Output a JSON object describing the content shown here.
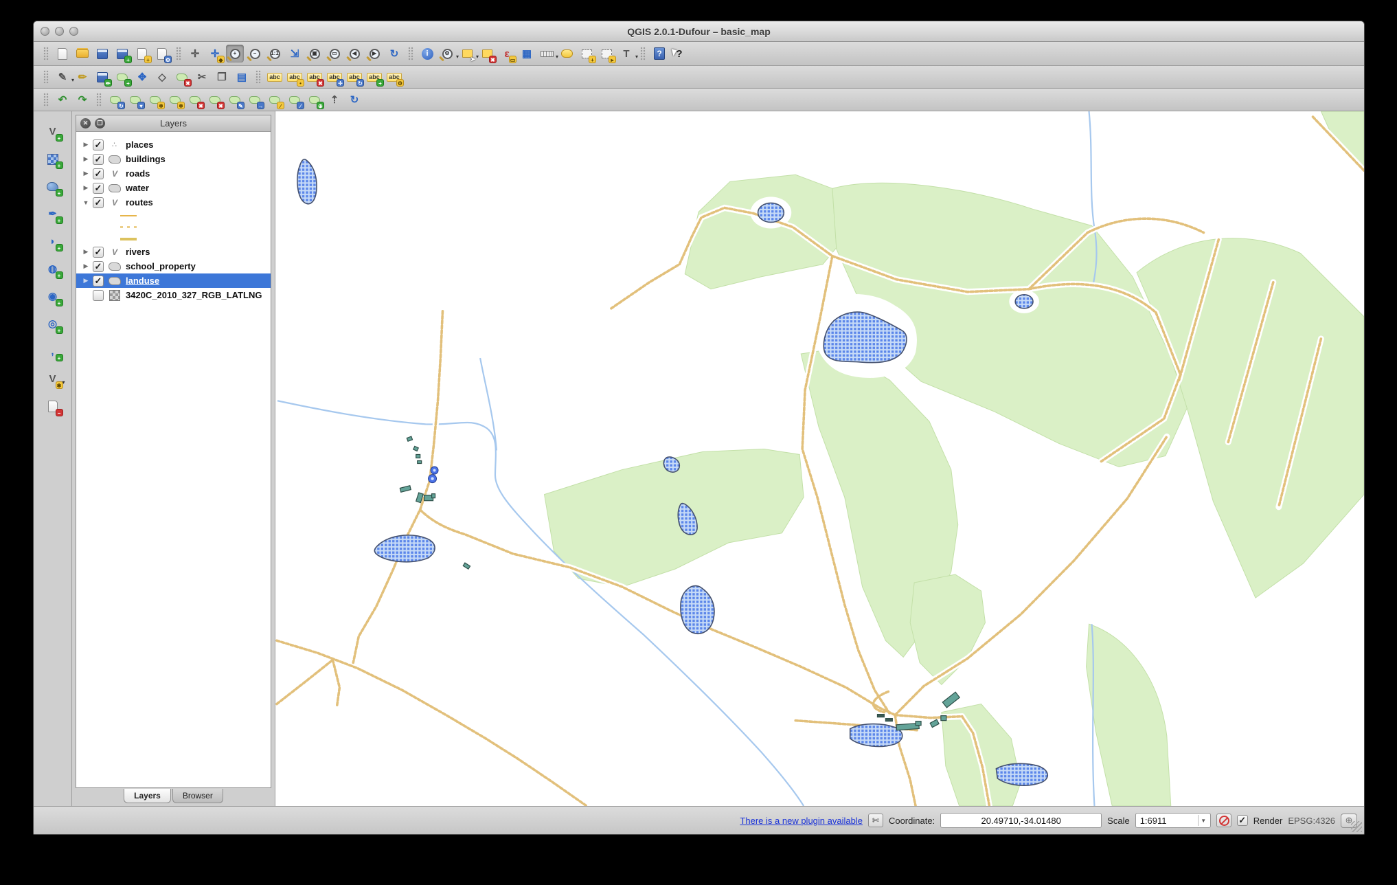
{
  "window": {
    "title": "QGIS 2.0.1-Dufour – basic_map"
  },
  "glyphs": {
    "check": "✓",
    "collapsed": "▶",
    "expanded": "▼",
    "dropdown": "▾",
    "points_icon": "∴",
    "line_icon": "V"
  },
  "toolbars": {
    "main": [
      {
        "sep": true
      },
      {
        "name": "new-project",
        "label": "New Project",
        "kind": "page"
      },
      {
        "name": "open-project",
        "label": "Open Project",
        "kind": "folder"
      },
      {
        "name": "save-project",
        "label": "Save Project",
        "kind": "save"
      },
      {
        "name": "save-project-as",
        "label": "Save Project As",
        "kind": "save",
        "badge": "+",
        "badge_tint": "green"
      },
      {
        "name": "new-print-composer",
        "label": "New Print Composer",
        "kind": "page",
        "badge": "+",
        "badge_tint": "yellow"
      },
      {
        "name": "composer-manager",
        "label": "Composer Manager",
        "kind": "page",
        "badge": "⚙",
        "badge_tint": "blue"
      },
      {
        "sep": true
      },
      {
        "name": "pan-map",
        "label": "Pan Map",
        "kind": "glyph",
        "glyph": "✛",
        "tint": "gray"
      },
      {
        "name": "pan-to-selection",
        "label": "Pan Map to Selection",
        "kind": "glyph",
        "glyph": "✛",
        "tint": "blue",
        "badge": "◆",
        "badge_tint": "yellow"
      },
      {
        "name": "zoom-in",
        "label": "Zoom In",
        "kind": "mag",
        "glyph": "+",
        "active": true
      },
      {
        "name": "zoom-out",
        "label": "Zoom Out",
        "kind": "mag",
        "glyph": "−"
      },
      {
        "name": "zoom-actual",
        "label": "Zoom to Native Resolution",
        "kind": "mag",
        "glyph": "1:1"
      },
      {
        "name": "zoom-full",
        "label": "Zoom Full",
        "kind": "glyph",
        "glyph": "⇲",
        "tint": "blue"
      },
      {
        "name": "zoom-to-selection",
        "label": "Zoom to Selection",
        "kind": "mag",
        "glyph": "▣"
      },
      {
        "name": "zoom-to-layer",
        "label": "Zoom to Layer",
        "kind": "mag",
        "glyph": "▭"
      },
      {
        "name": "zoom-last",
        "label": "Zoom Last",
        "kind": "mag",
        "glyph": "◀"
      },
      {
        "name": "zoom-next",
        "label": "Zoom Next",
        "kind": "mag",
        "glyph": "▶"
      },
      {
        "name": "refresh-map",
        "label": "Refresh",
        "kind": "glyph",
        "glyph": "↻",
        "tint": "blue"
      },
      {
        "sep": true
      },
      {
        "name": "identify-features",
        "label": "Identify Features",
        "kind": "roundblue",
        "glyph": "i"
      },
      {
        "name": "run-feature-action",
        "label": "Run Feature Action",
        "kind": "mag",
        "glyph": "⚙",
        "dropdown": true
      },
      {
        "name": "select-features",
        "label": "Select Features",
        "kind": "selrect",
        "badge": "➤",
        "badge_tint": "cursor",
        "dropdown": true
      },
      {
        "name": "deselect-features",
        "label": "Deselect Features from All Layers",
        "kind": "selrect",
        "badge": "✖",
        "badge_tint": "red"
      },
      {
        "name": "select-by-expression",
        "label": "Select by Expression",
        "kind": "glyph",
        "glyph": "ε",
        "tint": "red",
        "badge": "▭",
        "badge_tint": "yellow"
      },
      {
        "name": "open-attribute-table",
        "label": "Open Attribute Table",
        "kind": "glyph",
        "glyph": "▦",
        "tint": "blue"
      },
      {
        "name": "measure-line",
        "label": "Measure Line",
        "kind": "ruler",
        "dropdown": true
      },
      {
        "name": "map-tips",
        "label": "Map Tips",
        "kind": "bubble"
      },
      {
        "name": "new-bookmark",
        "label": "New Bookmark",
        "kind": "bookmark",
        "badge": "+",
        "badge_tint": "yellow"
      },
      {
        "name": "show-bookmarks",
        "label": "Show Bookmarks",
        "kind": "bookmark",
        "badge": "▸",
        "badge_tint": "yellow"
      },
      {
        "name": "text-annotation",
        "label": "Text Annotation",
        "kind": "glyph",
        "glyph": "T",
        "tint": "gray",
        "dropdown": true
      },
      {
        "sep": true
      },
      {
        "name": "help-contents",
        "label": "Help Contents",
        "kind": "helpbook",
        "glyph": "?"
      },
      {
        "name": "whats-this",
        "label": "What's This?",
        "kind": "cursorq",
        "glyph": "?"
      }
    ],
    "digitizing": [
      {
        "sep": true
      },
      {
        "name": "current-edits",
        "label": "Current Edits",
        "kind": "glyph",
        "glyph": "✎",
        "tint": "gray",
        "dropdown": true
      },
      {
        "name": "toggle-editing",
        "label": "Toggle Editing",
        "kind": "glyph",
        "glyph": "✏",
        "tint": "yellow"
      },
      {
        "name": "save-layer-edits",
        "label": "Save Layer Edits",
        "kind": "save",
        "badge": "✏",
        "badge_tint": "green"
      },
      {
        "name": "add-feature",
        "label": "Add Feature",
        "kind": "blob",
        "badge": "+",
        "badge_tint": "green"
      },
      {
        "name": "move-feature",
        "label": "Move Feature",
        "kind": "glyph",
        "glyph": "✥",
        "tint": "blue"
      },
      {
        "name": "node-tool",
        "label": "Node Tool",
        "kind": "glyph",
        "glyph": "◇",
        "tint": "gray"
      },
      {
        "name": "delete-selected",
        "label": "Delete Selected",
        "kind": "blob",
        "badge": "✖",
        "badge_tint": "red"
      },
      {
        "name": "cut-features",
        "label": "Cut Features",
        "kind": "glyph",
        "glyph": "✂",
        "tint": "gray"
      },
      {
        "name": "copy-features",
        "label": "Copy Features",
        "kind": "glyph",
        "glyph": "❐",
        "tint": "gray"
      },
      {
        "name": "paste-features",
        "label": "Paste Features",
        "kind": "glyph",
        "glyph": "▤",
        "tint": "blue"
      },
      {
        "sep": true
      },
      {
        "name": "labeling",
        "label": "Layer Labeling Options",
        "kind": "abc",
        "glyph": "abc"
      },
      {
        "name": "label-pin",
        "label": "Pin/Unpin Labels",
        "kind": "abc",
        "glyph": "abc",
        "badge": "•",
        "badge_tint": "yellow"
      },
      {
        "name": "label-highlight",
        "label": "Highlight Pinned Labels",
        "kind": "abc",
        "glyph": "abc",
        "badge": "✖",
        "badge_tint": "red"
      },
      {
        "name": "label-move",
        "label": "Move Label",
        "kind": "abc",
        "glyph": "abc",
        "badge": "✛",
        "badge_tint": "blue"
      },
      {
        "name": "label-rotate",
        "label": "Rotate Label",
        "kind": "abc",
        "glyph": "abc",
        "badge": "↻",
        "badge_tint": "blue"
      },
      {
        "name": "label-change",
        "label": "Change Label",
        "kind": "abc",
        "glyph": "abc",
        "badge": "+",
        "badge_tint": "green"
      },
      {
        "name": "label-properties",
        "label": "Label Properties",
        "kind": "abc",
        "glyph": "abc",
        "badge": "⚙",
        "badge_tint": "yellow"
      }
    ],
    "advanced_digitizing": [
      {
        "sep": true
      },
      {
        "name": "undo",
        "label": "Undo",
        "kind": "glyph",
        "glyph": "↶",
        "tint": "green"
      },
      {
        "name": "redo",
        "label": "Redo",
        "kind": "glyph",
        "glyph": "↷",
        "tint": "green"
      },
      {
        "sep": true
      },
      {
        "name": "rotate-feature",
        "label": "Rotate Feature",
        "kind": "blob",
        "badge": "↻",
        "badge_tint": "blue"
      },
      {
        "name": "simplify-feature",
        "label": "Simplify Feature",
        "kind": "blob",
        "badge": "▾",
        "badge_tint": "blue"
      },
      {
        "name": "add-ring",
        "label": "Add Ring",
        "kind": "blob",
        "badge": "❄",
        "badge_tint": "yellow"
      },
      {
        "name": "fill-ring",
        "label": "Fill Ring",
        "kind": "blob",
        "badge": "❄",
        "badge_tint": "yellow"
      },
      {
        "name": "delete-ring",
        "label": "Delete Ring",
        "kind": "blob",
        "badge": "✖",
        "badge_tint": "red"
      },
      {
        "name": "delete-part",
        "label": "Delete Part",
        "kind": "blob",
        "badge": "✖",
        "badge_tint": "red"
      },
      {
        "name": "reshape-features",
        "label": "Reshape Features",
        "kind": "blob",
        "badge": "✎",
        "badge_tint": "blue"
      },
      {
        "name": "offset-curve",
        "label": "Offset Curve",
        "kind": "blob",
        "badge": "→",
        "badge_tint": "blue"
      },
      {
        "name": "split-features",
        "label": "Split Features",
        "kind": "blob",
        "badge": "∕",
        "badge_tint": "yellow"
      },
      {
        "name": "split-parts",
        "label": "Split Parts",
        "kind": "blob",
        "badge": "∕",
        "badge_tint": "blue"
      },
      {
        "name": "merge-features",
        "label": "Merge Selected Features",
        "kind": "blob",
        "badge": "⊕",
        "badge_tint": "green"
      },
      {
        "name": "merge-attributes",
        "label": "Merge Attributes of Selected Features",
        "kind": "glyph",
        "glyph": "⇡",
        "tint": "gray"
      },
      {
        "name": "rotate-point-symbols",
        "label": "Rotate Point Symbols",
        "kind": "glyph",
        "glyph": "↻",
        "tint": "blue"
      }
    ],
    "manage_layers": [
      {
        "name": "add-vector-layer",
        "label": "Add Vector Layer",
        "kind": "glyph",
        "glyph": "V",
        "tint": "gray",
        "badge": "+",
        "badge_tint": "green"
      },
      {
        "name": "add-raster-layer",
        "label": "Add Raster Layer",
        "kind": "checker",
        "badge": "+",
        "badge_tint": "green"
      },
      {
        "name": "add-postgis-layer",
        "label": "Add PostGIS Layer",
        "kind": "pg",
        "badge": "+",
        "badge_tint": "green"
      },
      {
        "name": "add-spatialite-layer",
        "label": "Add SpatiaLite Layer",
        "kind": "glyph",
        "glyph": "✒",
        "tint": "blue",
        "badge": "+",
        "badge_tint": "green"
      },
      {
        "name": "add-mssql-layer",
        "label": "Add MSSQL Spatial Layer",
        "kind": "glyph",
        "glyph": "◗",
        "tint": "blue",
        "badge": "+",
        "badge_tint": "green"
      },
      {
        "name": "add-wms-layer",
        "label": "Add WMS/WMTS Layer",
        "kind": "glyph",
        "glyph": "◍",
        "tint": "blue",
        "badge": "+",
        "badge_tint": "green"
      },
      {
        "name": "add-wcs-layer",
        "label": "Add WCS Layer",
        "kind": "glyph",
        "glyph": "◉",
        "tint": "blue",
        "badge": "+",
        "badge_tint": "green"
      },
      {
        "name": "add-wfs-layer",
        "label": "Add WFS Layer",
        "kind": "glyph",
        "glyph": "◎",
        "tint": "blue",
        "badge": "+",
        "badge_tint": "green"
      },
      {
        "name": "add-delimited-text-layer",
        "label": "Add Delimited Text Layer",
        "kind": "glyph",
        "glyph": ",",
        "tint": "blue",
        "badge": "+",
        "badge_tint": "green"
      },
      {
        "name": "new-shapefile-layer",
        "label": "New Shapefile Layer",
        "kind": "glyph",
        "glyph": "V",
        "tint": "gray",
        "badge": "✱",
        "badge_tint": "yellow",
        "dropdown": true
      },
      {
        "name": "remove-layer",
        "label": "Remove Layer",
        "kind": "page",
        "badge": "−",
        "badge_tint": "red"
      }
    ]
  },
  "layers_panel": {
    "title": "Layers",
    "header_buttons": [
      {
        "name": "close-panel",
        "glyph": "✕"
      },
      {
        "name": "float-panel",
        "glyph": "❐"
      }
    ],
    "layers": [
      {
        "name": "places",
        "checked": true,
        "expand": "collapsed",
        "icon": "points"
      },
      {
        "name": "buildings",
        "checked": true,
        "expand": "collapsed",
        "icon": "polygon"
      },
      {
        "name": "roads",
        "checked": true,
        "expand": "collapsed",
        "icon": "line"
      },
      {
        "name": "water",
        "checked": true,
        "expand": "collapsed",
        "icon": "polygon"
      },
      {
        "name": "routes",
        "checked": true,
        "expand": "expanded",
        "icon": "line",
        "children": [
          {
            "swatch": "thin-line"
          },
          {
            "swatch": "dashed-line"
          },
          {
            "swatch": "thick-line"
          }
        ]
      },
      {
        "name": "rivers",
        "checked": true,
        "expand": "collapsed",
        "icon": "line"
      },
      {
        "name": "school_property",
        "checked": true,
        "expand": "collapsed",
        "icon": "polygon"
      },
      {
        "name": "landuse",
        "checked": true,
        "expand": "collapsed",
        "icon": "polygon",
        "selected": true
      },
      {
        "name": "3420C_2010_327_RGB_LATLNG",
        "checked": false,
        "expand": "none",
        "icon": "raster"
      }
    ],
    "tabs": [
      {
        "label": "Layers",
        "active": true
      },
      {
        "label": "Browser",
        "active": false
      }
    ]
  },
  "status_bar": {
    "plugin_link": "There is a new plugin available",
    "plugin_icon_glyph": "✄",
    "coordinate_label": "Coordinate:",
    "coordinate_value": "20.49710,-34.01480",
    "scale_label": "Scale",
    "scale_value": "1:6911",
    "render_label": "Render",
    "crs_label": "EPSG:4326",
    "crs_globe_glyph": "⊕"
  },
  "map": {
    "visible_layers": [
      "places",
      "buildings",
      "roads",
      "water",
      "routes",
      "rivers",
      "school_property",
      "landuse"
    ],
    "colors": {
      "landuse_fill": "#daf0c6",
      "landuse_stroke": "#c3e0a8",
      "water_light": "#c7dbf7",
      "water_grid": "#5b86ea",
      "water_stroke": "#45516f",
      "road": "#e2c07b",
      "river": "#a6c8ee",
      "building_fill": "#63a398",
      "building_stroke": "#2e4f48",
      "place_marker": "#4a72e8",
      "background": "#ffffff"
    }
  }
}
